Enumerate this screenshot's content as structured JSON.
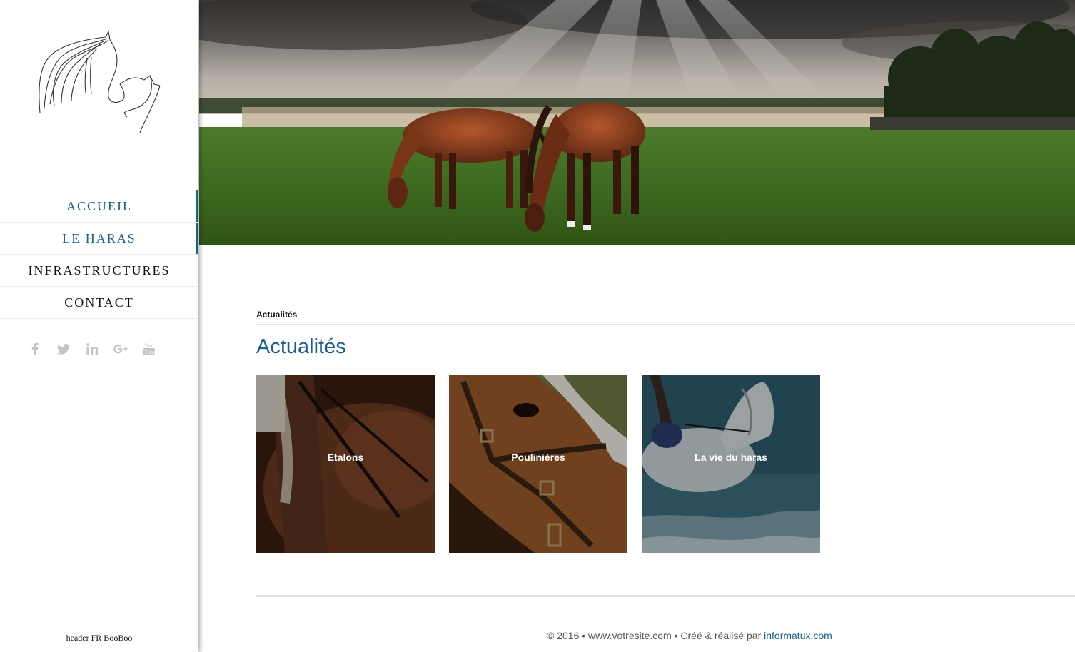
{
  "sidebar": {
    "nav": [
      {
        "label": "ACCUEIL",
        "active": true
      },
      {
        "label": "LE HARAS",
        "active": true
      },
      {
        "label": "INFRASTRUCTURES",
        "active": false
      },
      {
        "label": "CONTACT",
        "active": false
      }
    ],
    "social": [
      "facebook-icon",
      "twitter-icon",
      "linkedin-icon",
      "google-plus-icon",
      "youtube-icon"
    ],
    "footer_text": "header FR BooBoo"
  },
  "main": {
    "breadcrumb": "Actualités",
    "title": "Actualités",
    "cards": [
      {
        "label": "Etalons"
      },
      {
        "label": "Poulinières"
      },
      {
        "label": "La vie du haras"
      }
    ]
  },
  "footer": {
    "copyright": "© 2016 • www.votresite.com • Créé & réalisé par",
    "link": "informatux.com"
  },
  "colors": {
    "accent": "#1d5d8e"
  }
}
